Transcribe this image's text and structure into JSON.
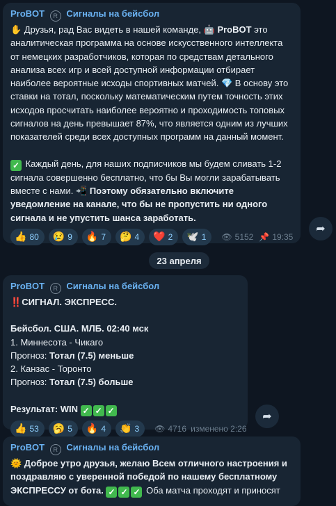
{
  "channel": {
    "name": "ProBOT",
    "title": "Сигналы на бейсбол",
    "sep_icon": "R"
  },
  "post1": {
    "lead_emoji": "✋",
    "p1a": " Друзья, рад Вас видеть в нашей команде, ",
    "robot_emoji": "🤖",
    "p1b": " ProBOT",
    "p1c": " это аналитическая программа на основе искусственного интеллекта от немецких разработчиков, которая по средствам детального анализа всех игр и всей доступной информации отбирает наиболее вероятные исходы спортивных матчей. ",
    "gem_emoji": "💎",
    "p1d": " В основу это ставки на тотал, поскольку математическим путем точность этих исходов просчитать наиболее вероятно и проходимость топовых сигналов на день превышает 87%, что является одним из лучших показателей среди всех доступных программ на данный момент.",
    "p2a": " Каждый день, для наших подписчиков мы будем сливать 1-2 сигнала совершенно бесплатно, что бы Вы могли зарабатывать вместе с нами. ",
    "phone_emoji": "📲",
    "p2b": " Поэтому обязательно включите уведомление на канале, что бы не пропустить ни одного сигнала и не упустить шанса заработать.",
    "reactions": [
      {
        "emoji": "👍",
        "count": "80"
      },
      {
        "emoji": "😢",
        "count": "9"
      },
      {
        "emoji": "🔥",
        "count": "7"
      },
      {
        "emoji": "🤔",
        "count": "4"
      },
      {
        "emoji": "❤️",
        "count": "2"
      },
      {
        "emoji": "🕊️",
        "count": "1"
      }
    ],
    "views": "5152",
    "time": "19:35"
  },
  "date_separator": "23 апреля",
  "post2": {
    "bang": "‼️",
    "signal_title": "СИГНАЛ. ЭКСПРЕСС.",
    "league_line": "Бейсбол. США. МЛБ. 02:40 мск",
    "match1": "1. Миннесота - Чикаго",
    "pred_label": "Прогноз: ",
    "pred1": " Тотал  (7.5) меньше",
    "match2": "2. Канзас  - Торонто",
    "pred2": " Тотал  (7.5) больше",
    "result_label": "Результат: WIN ",
    "reactions": [
      {
        "emoji": "👍",
        "count": "53"
      },
      {
        "emoji": "🥱",
        "count": "5"
      },
      {
        "emoji": "🔥",
        "count": "4"
      },
      {
        "emoji": "👏",
        "count": "3"
      }
    ],
    "views": "4716",
    "edited": "изменено 2:26"
  },
  "post3": {
    "sun_emoji": "🌞",
    "p1": " Доброе утро друзья, желаю Всем отличного настроения и поздравляю с уверенной победой по нашему бесплатному ЭКСПРЕССУ от бота.",
    "p2": " Оба матча проходят и приносят"
  },
  "icons": {
    "views": "👁",
    "pin": "📌",
    "share": "➦",
    "check": "✓"
  },
  "colors": {
    "bg": "#0e1621",
    "bubble": "#182533",
    "accent": "#6ab2f2",
    "reaction": "#23394d"
  }
}
